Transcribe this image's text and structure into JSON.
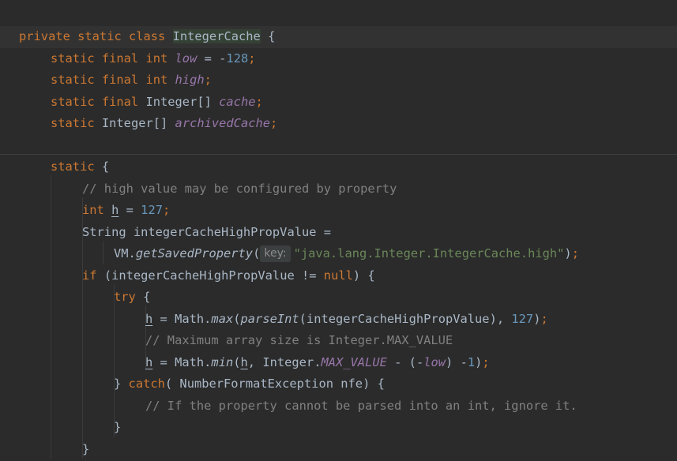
{
  "editor": {
    "lines": {
      "l1": {
        "kw": "private static class ",
        "cls": "IntegerCache",
        "rest": " {"
      },
      "l2": {
        "kw": "static final int ",
        "field": "low",
        "op": " = -",
        "num": "128",
        "semi": ";"
      },
      "l3": {
        "kw": "static final int ",
        "field": "high",
        "semi": ";"
      },
      "l4": {
        "kw": "static final ",
        "type": "Integer[] ",
        "field": "cache",
        "semi": ";"
      },
      "l5": {
        "kw": "static ",
        "type": "Integer[] ",
        "field": "archivedCache",
        "semi": ";"
      },
      "l6": {
        "kw": "static",
        "rest": " {"
      },
      "l7": {
        "comment": "// high value may be configured by property"
      },
      "l8": {
        "kw": "int ",
        "var": "h",
        "op": " = ",
        "num": "127",
        "semi": ";"
      },
      "l9": {
        "text": "String integerCacheHighPropValue ="
      },
      "l10": {
        "obj": "VM.",
        "method": "getSavedProperty",
        "open": "(",
        "hint": "key:",
        "str": "\"java.lang.Integer.IntegerCache.high\"",
        "close": ")",
        "semi": ";"
      },
      "l11": {
        "kw": "if ",
        "mid": "(integerCacheHighPropValue != ",
        "kw2": "null",
        "rest": ") {"
      },
      "l12": {
        "kw": "try",
        "rest": " {"
      },
      "l13": {
        "var": "h",
        "a": " = Math.",
        "m1": "max",
        "b": "(",
        "m2": "parseInt",
        "c": "(integerCacheHighPropValue), ",
        "num": "127",
        "d": ")",
        "semi": ";"
      },
      "l14": {
        "comment": "// Maximum array size is Integer.MAX_VALUE"
      },
      "l15": {
        "var": "h",
        "a": " = Math.",
        "m1": "min",
        "b": "(",
        "var2": "h",
        "c": ", Integer.",
        "field": "MAX_VALUE",
        "d": " - (-",
        "field2": "low",
        "e": ") -",
        "num": "1",
        "f": ")",
        "semi": ";"
      },
      "l16": {
        "brace": "} ",
        "kw": "catch",
        "rest": "( NumberFormatException nfe) {"
      },
      "l17": {
        "comment": "// If the property cannot be parsed into an int, ignore it."
      },
      "l18": {
        "text": "}"
      },
      "l19": {
        "text": "}"
      }
    }
  }
}
